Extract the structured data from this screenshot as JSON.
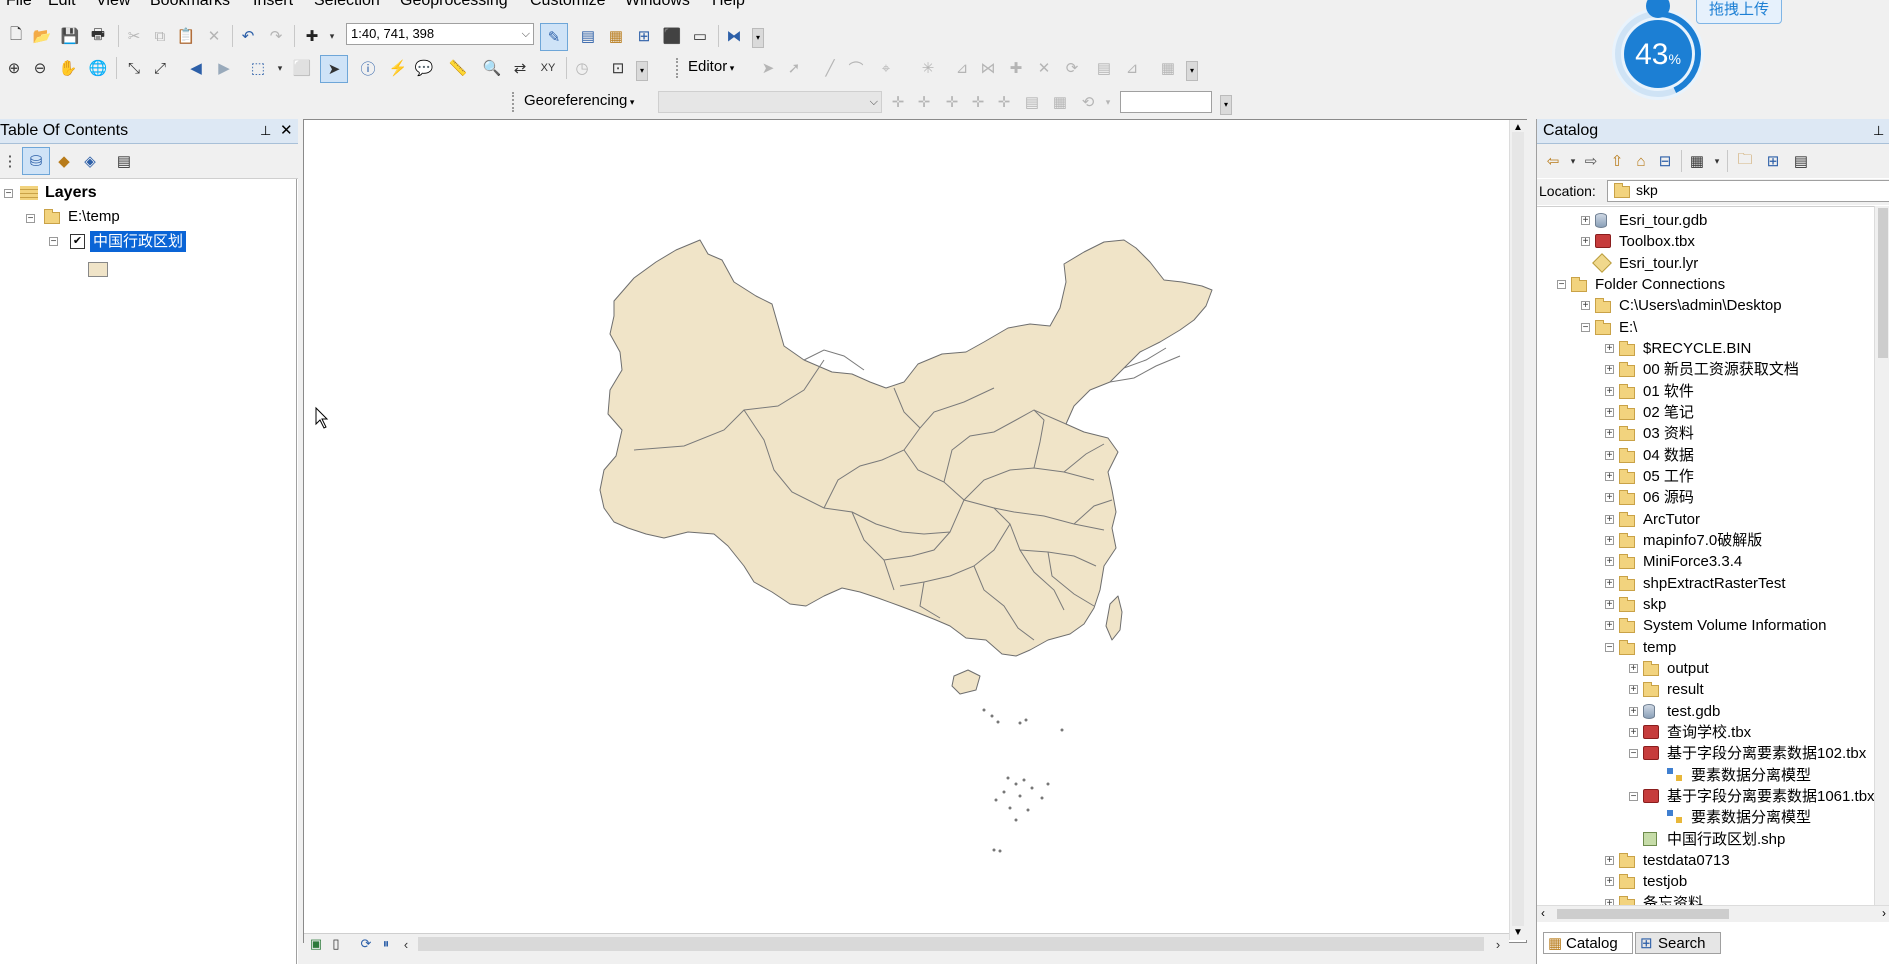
{
  "menu": [
    "File",
    "Edit",
    "View",
    "Bookmarks",
    "Insert",
    "Selection",
    "Geoprocessing",
    "Customize",
    "Windows",
    "Help"
  ],
  "toolbar": {
    "scale_value": "1:40, 741, 398",
    "editor_label": "Editor",
    "georef_label": "Georeferencing",
    "georef_layer_value": "",
    "georef_field_value": ""
  },
  "upload_widget": {
    "percent": "43",
    "percent_sign": "%",
    "button_label": "拖拽上传",
    "progress_fraction": 0.43
  },
  "toc": {
    "title": "Table Of Contents",
    "root_label": "Layers",
    "group_label": "E:\\temp",
    "layer_label": "中国行政区划",
    "layer_checked": true
  },
  "catalog": {
    "title": "Catalog",
    "location_label": "Location:",
    "location_value": "skp",
    "items": [
      {
        "label": "Esri_tour.gdb",
        "type": "gdb",
        "level": 1,
        "exp": "+"
      },
      {
        "label": "Toolbox.tbx",
        "type": "tbx",
        "level": 1,
        "exp": "+"
      },
      {
        "label": "Esri_tour.lyr",
        "type": "lyr",
        "level": 1,
        "exp": ""
      },
      {
        "label": "Folder Connections",
        "type": "folder",
        "level": 0,
        "exp": "-"
      },
      {
        "label": "C:\\Users\\admin\\Desktop",
        "type": "folder",
        "level": 1,
        "exp": "+"
      },
      {
        "label": "E:\\",
        "type": "folder",
        "level": 1,
        "exp": "-"
      },
      {
        "label": "$RECYCLE.BIN",
        "type": "folder",
        "level": 2,
        "exp": "+"
      },
      {
        "label": "00 新员工资源获取文档",
        "type": "folder",
        "level": 2,
        "exp": "+"
      },
      {
        "label": "01 软件",
        "type": "folder",
        "level": 2,
        "exp": "+"
      },
      {
        "label": "02 笔记",
        "type": "folder",
        "level": 2,
        "exp": "+"
      },
      {
        "label": "03 资料",
        "type": "folder",
        "level": 2,
        "exp": "+"
      },
      {
        "label": "04 数据",
        "type": "folder",
        "level": 2,
        "exp": "+"
      },
      {
        "label": "05 工作",
        "type": "folder",
        "level": 2,
        "exp": "+"
      },
      {
        "label": "06 源码",
        "type": "folder",
        "level": 2,
        "exp": "+"
      },
      {
        "label": "ArcTutor",
        "type": "folder",
        "level": 2,
        "exp": "+"
      },
      {
        "label": "mapinfo7.0破解版",
        "type": "folder",
        "level": 2,
        "exp": "+"
      },
      {
        "label": "MiniForce3.3.4",
        "type": "folder",
        "level": 2,
        "exp": "+"
      },
      {
        "label": "shpExtractRasterTest",
        "type": "folder",
        "level": 2,
        "exp": "+"
      },
      {
        "label": "skp",
        "type": "folder",
        "level": 2,
        "exp": "+"
      },
      {
        "label": "System Volume Information",
        "type": "folder",
        "level": 2,
        "exp": "+"
      },
      {
        "label": "temp",
        "type": "folder",
        "level": 2,
        "exp": "-"
      },
      {
        "label": "output",
        "type": "folder",
        "level": 3,
        "exp": "+"
      },
      {
        "label": "result",
        "type": "folder",
        "level": 3,
        "exp": "+"
      },
      {
        "label": "test.gdb",
        "type": "gdb",
        "level": 3,
        "exp": "+"
      },
      {
        "label": "查询学校.tbx",
        "type": "tbx",
        "level": 3,
        "exp": "+"
      },
      {
        "label": "基于字段分离要素数据102.tbx",
        "type": "tbx",
        "level": 3,
        "exp": "-"
      },
      {
        "label": "要素数据分离模型",
        "type": "model",
        "level": 4,
        "exp": ""
      },
      {
        "label": "基于字段分离要素数据1061.tbx",
        "type": "tbx",
        "level": 3,
        "exp": "-"
      },
      {
        "label": "要素数据分离模型",
        "type": "model",
        "level": 4,
        "exp": ""
      },
      {
        "label": "中国行政区划.shp",
        "type": "shp",
        "level": 3,
        "exp": ""
      },
      {
        "label": "testdata0713",
        "type": "folder",
        "level": 2,
        "exp": "+"
      },
      {
        "label": "testjob",
        "type": "folder",
        "level": 2,
        "exp": "+"
      },
      {
        "label": "备忘资料",
        "type": "folder",
        "level": 2,
        "exp": "+"
      }
    ],
    "tabs": [
      {
        "label": "Catalog",
        "active": true
      },
      {
        "label": "Search",
        "active": false
      }
    ]
  },
  "colors": {
    "map_fill": "#f0e4c8",
    "map_outline": "#6e6e6e",
    "selection": "#0a64d6",
    "panel_title_bg": "#dde8f4",
    "upload_blue": "#1c7fd4"
  },
  "icons": {
    "close": "✕",
    "pin": "📌",
    "expand": "+",
    "collapse": "−"
  }
}
